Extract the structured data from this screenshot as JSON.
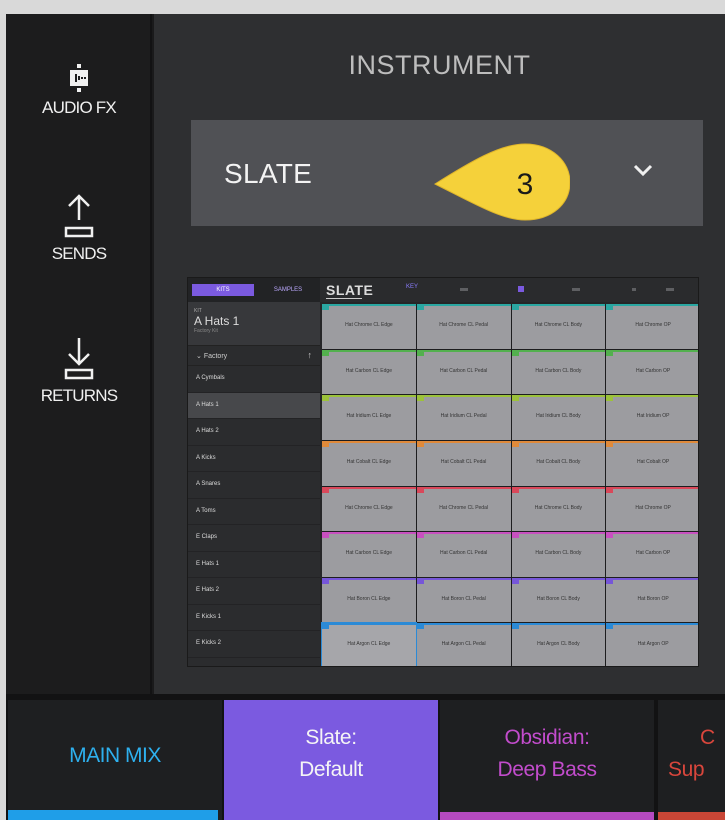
{
  "rail": {
    "audio_fx": "AUDIO FX",
    "sends": "SENDS",
    "returns": "RETURNS"
  },
  "instrument": {
    "title": "INSTRUMENT",
    "selected": "SLATE",
    "callout_number": "3"
  },
  "thumbnail": {
    "tab_kits": "KITS",
    "tab_samples": "SAMPLES",
    "logo": "SLATE",
    "key_label": "KEY",
    "kit_label": "KIT",
    "kit_name": "A Hats 1",
    "kit_sub": "Factory Kit",
    "folder": "Factory",
    "list": [
      "A Cymbals",
      "A Hats 1",
      "A Hats 2",
      "A Kicks",
      "A Snares",
      "A Toms",
      "E Claps",
      "E Hats 1",
      "E Hats 2",
      "E Kicks 1",
      "E Kicks 2"
    ],
    "selected_index": 1,
    "pad_rows": [
      {
        "color": "#2aa7a2",
        "names": [
          "Hat Chrome CL Edge",
          "Hat Chrome CL Pedal",
          "Hat Chrome CL Body",
          "Hat Chrome OP"
        ]
      },
      {
        "color": "#53b04e",
        "names": [
          "Hat Carbon CL Edge",
          "Hat Carbon CL Pedal",
          "Hat Carbon CL Body",
          "Hat Carbon OP"
        ]
      },
      {
        "color": "#9cc23a",
        "names": [
          "Hat Iridium CL Edge",
          "Hat Iridium CL Pedal",
          "Hat Iridium CL Body",
          "Hat Iridium OP"
        ]
      },
      {
        "color": "#e08a3a",
        "names": [
          "Hat Cobalt CL Edge",
          "Hat Cobalt CL Pedal",
          "Hat Cobalt CL Body",
          "Hat Cobalt OP"
        ]
      },
      {
        "color": "#d9485a",
        "names": [
          "Hat Chrome CL Edge",
          "Hat Chrome CL Pedal",
          "Hat Chrome CL Body",
          "Hat Chrome OP"
        ]
      },
      {
        "color": "#c850c0",
        "names": [
          "Hat Carbon CL Edge",
          "Hat Carbon CL Pedal",
          "Hat Carbon CL Body",
          "Hat Carbon OP"
        ]
      },
      {
        "color": "#7656d8",
        "names": [
          "Hat Boron CL Edge",
          "Hat Boron CL Pedal",
          "Hat Boron CL Body",
          "Hat Boron OP"
        ]
      },
      {
        "color": "#2b8ad6",
        "names": [
          "Hat Argon CL Edge",
          "Hat Argon CL Pedal",
          "Hat Argon CL Body",
          "Hat Argon OP"
        ]
      }
    ]
  },
  "tracks": {
    "main_mix": "MAIN MIX",
    "slate_line1": "Slate:",
    "slate_line2": "Default",
    "obsidian_line1": "Obsidian:",
    "obsidian_line2": "Deep Bass",
    "next_line1": "C",
    "next_line2": "Sup"
  },
  "colors": {
    "accent_purple": "#7b5ae0",
    "main_mix_blue": "#2eb0ee",
    "obsidian_magenta": "#c24ccc",
    "callout_yellow": "#f5d13a",
    "next_red": "#d9463c"
  }
}
